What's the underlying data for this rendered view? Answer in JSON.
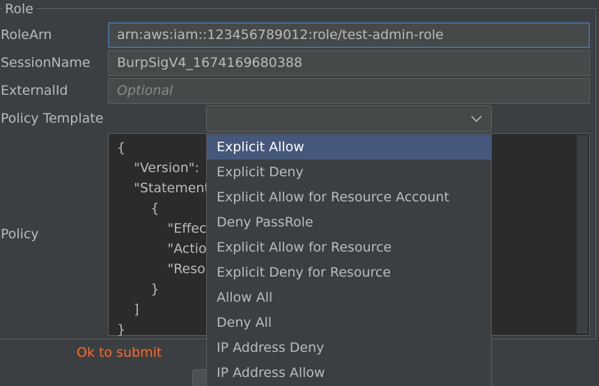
{
  "group": {
    "title": "Role"
  },
  "fields": {
    "role_arn": {
      "label": "RoleArn",
      "value": "arn:aws:iam::123456789012:role/test-admin-role"
    },
    "session_name": {
      "label": "SessionName",
      "value": "BurpSigV4_1674169680388"
    },
    "external_id": {
      "label": "ExternalId",
      "value": "",
      "placeholder": "Optional"
    },
    "policy_template": {
      "label": "Policy Template",
      "value": ""
    },
    "policy": {
      "label": "Policy",
      "lines": [
        "{",
        "    \"Version\":",
        "    \"Statement",
        "        {",
        "            \"Effec",
        "            \"Actio",
        "            \"Reso",
        "        }",
        "    ]",
        "}"
      ]
    }
  },
  "status": {
    "text": "Ok to submit",
    "color": "#ff6a2b"
  },
  "dropdown": {
    "selected_index": 0,
    "options": [
      "Explicit Allow",
      "Explicit Deny",
      "Explicit Allow for Resource Account",
      "Deny PassRole",
      "Explicit Allow for Resource",
      "Explicit Deny for Resource",
      "Allow All",
      "Deny All",
      "IP Address Deny",
      "IP Address Allow"
    ]
  },
  "icons": {
    "combo_arrow": "chevron-down-icon"
  },
  "colors": {
    "background": "#3c3f41",
    "field_bg": "#45494a",
    "focus_border": "#466d94",
    "selection": "#45577a",
    "status": "#ff6a2b"
  }
}
